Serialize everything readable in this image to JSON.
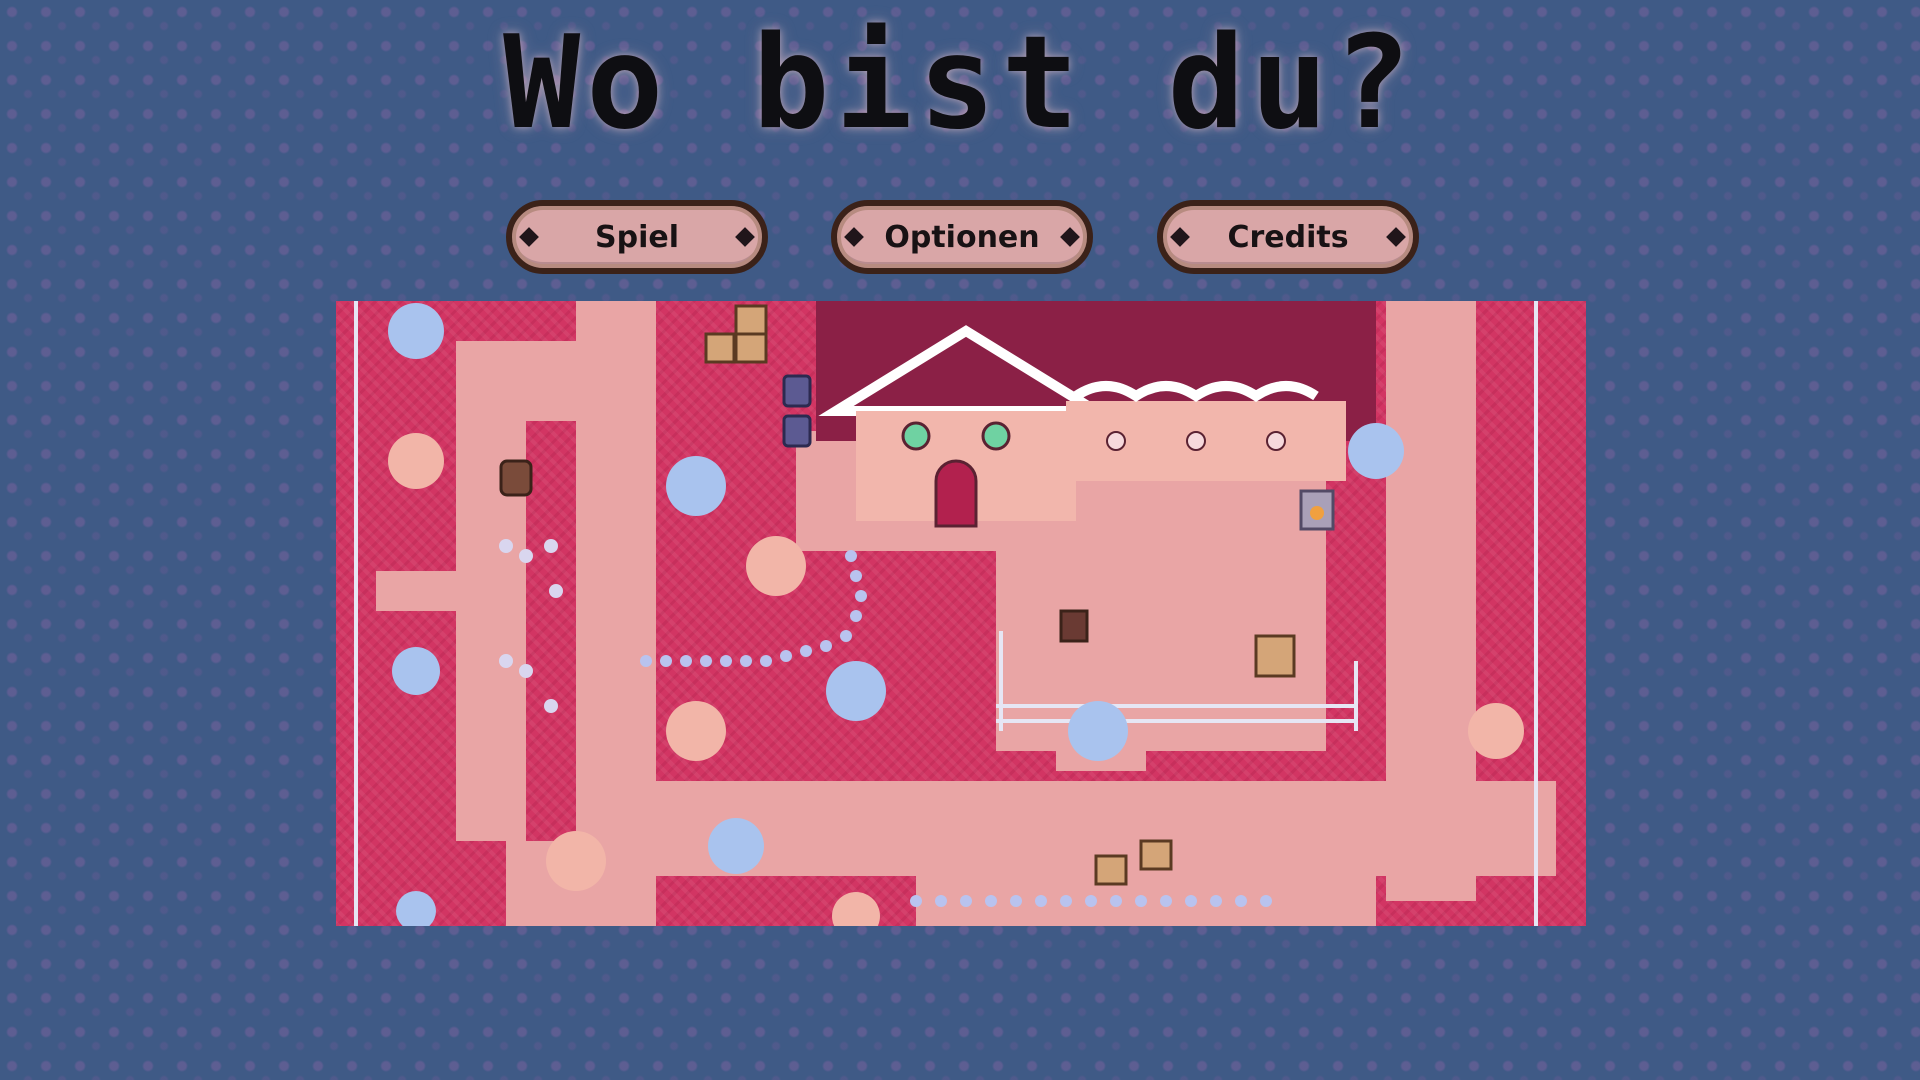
{
  "title": "Wo bist du?",
  "menu": {
    "buttons": [
      {
        "label": "Spiel"
      },
      {
        "label": "Optionen"
      },
      {
        "label": "Credits"
      }
    ]
  },
  "colors": {
    "background": "#3f5a86",
    "grass": "#d23563",
    "path": "#e9a5a5",
    "roof": "#8b2046",
    "button_face": "#d9a6a7",
    "button_border": "#3b2219",
    "tree_blue": "#a9c3ee",
    "tree_peach": "#f2b5a8"
  },
  "map": {
    "icons": [
      "house-icon",
      "tree-icon",
      "barrel-icon",
      "crate-icon",
      "fence-icon",
      "chest-icon",
      "sign-icon",
      "lantern-icon",
      "flower-icon"
    ]
  }
}
